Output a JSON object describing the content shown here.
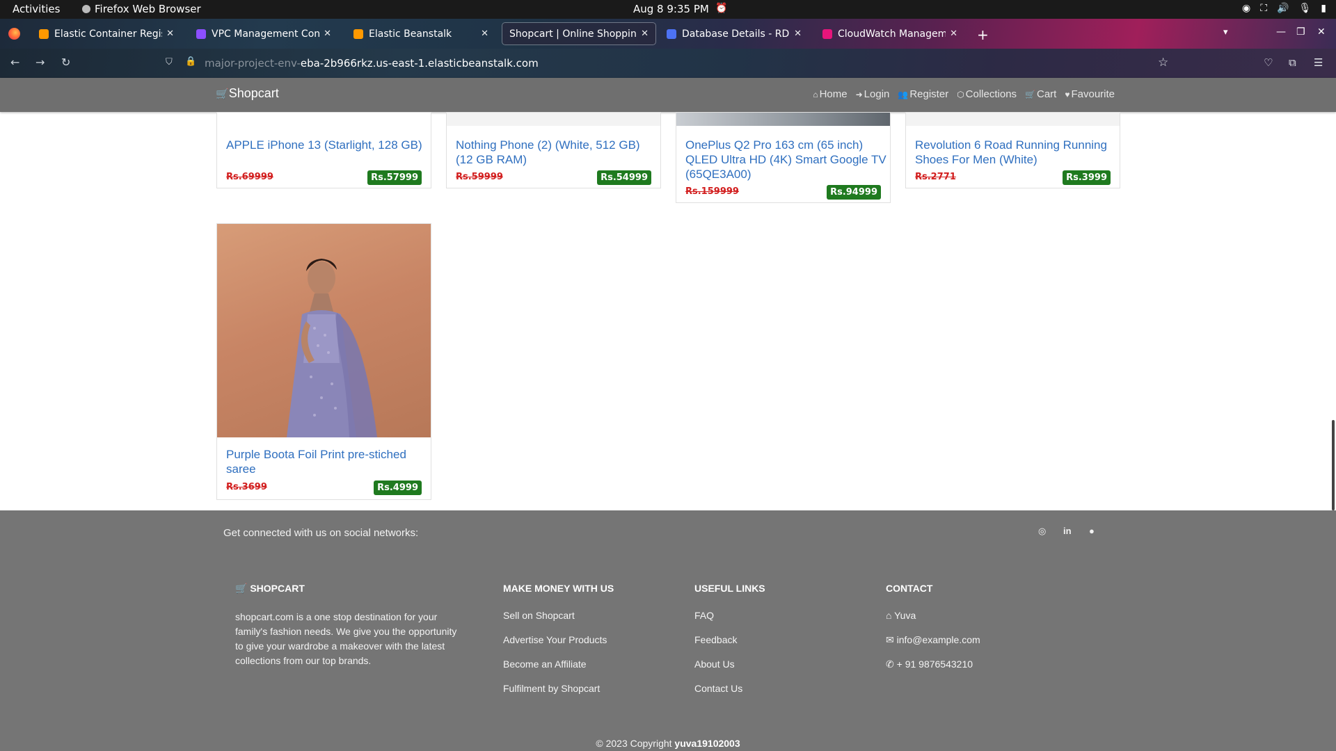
{
  "os_bar": {
    "activities": "Activities",
    "app_name": "Firefox Web Browser",
    "clock": "Aug 8  9:35 PM"
  },
  "browser": {
    "tabs": [
      {
        "label": "Elastic Container Registr",
        "favicon_color": "#ff9900",
        "active": false
      },
      {
        "label": "VPC Management Conso",
        "favicon_color": "#8c4fff",
        "active": false
      },
      {
        "label": "Elastic Beanstalk",
        "favicon_color": "#ff9900",
        "active": false
      },
      {
        "label": "Shopcart | Online Shopping",
        "favicon_color": "",
        "active": true
      },
      {
        "label": "Database Details - RDS M",
        "favicon_color": "#4d72f3",
        "active": false
      },
      {
        "label": "CloudWatch Managemen",
        "favicon_color": "#e7157b",
        "active": false
      }
    ],
    "new_tab": "+",
    "url_dim": "major-project-env-",
    "url_main": "eba-2b966rkz.us-east-1.elasticbeanstalk.com"
  },
  "site": {
    "brand": "Shopcart",
    "nav": [
      {
        "label": "Home",
        "icon": "home-icon"
      },
      {
        "label": "Login",
        "icon": "login-icon"
      },
      {
        "label": "Register",
        "icon": "users-icon"
      },
      {
        "label": "Collections",
        "icon": "cubes-icon"
      },
      {
        "label": "Cart",
        "icon": "cart-icon"
      },
      {
        "label": "Favourite",
        "icon": "heart-icon"
      }
    ]
  },
  "products": [
    {
      "title": "APPLE iPhone 13 (Starlight, 128 GB)",
      "old_price": "Rs.69999",
      "price": "Rs.57999"
    },
    {
      "title": "Nothing Phone (2) (White, 512 GB) (12 GB RAM)",
      "old_price": "Rs.59999",
      "price": "Rs.54999"
    },
    {
      "title": "OnePlus Q2 Pro 163 cm (65 inch) QLED Ultra HD (4K) Smart Google TV (65QE3A00)",
      "old_price": "Rs.159999",
      "price": "Rs.94999"
    },
    {
      "title": "Revolution 6 Road Running Running Shoes For Men (White)",
      "old_price": "Rs.2771",
      "price": "Rs.3999"
    },
    {
      "title": "Purple Boota Foil Print pre-stiched saree",
      "old_price": "Rs.3699",
      "price": "Rs.4999"
    }
  ],
  "footer": {
    "social_text": "Get connected with us on social networks:",
    "social_icons": [
      "instagram-icon",
      "linkedin-icon",
      "github-icon"
    ],
    "col1": {
      "heading": "SHOPCART",
      "text": "shopcart.com is a one stop destination for your family's fashion needs. We give you the opportunity to give your wardrobe a makeover with the latest collections from our top brands."
    },
    "col2": {
      "heading": "MAKE MONEY WITH US",
      "links": [
        "Sell on Shopcart",
        "Advertise Your Products",
        "Become an Affiliate",
        "Fulfilment by Shopcart"
      ]
    },
    "col3": {
      "heading": "USEFUL LINKS",
      "links": [
        "FAQ",
        "Feedback",
        "About Us",
        "Contact Us"
      ]
    },
    "col4": {
      "heading": "CONTACT",
      "items": [
        "Yuva",
        "info@example.com",
        "+ 91 9876543210"
      ]
    },
    "copyright_prefix": "© 2023 Copyright ",
    "copyright_owner": "yuva19102003"
  },
  "colors": {
    "site_nav_bg": "#6f6f6f",
    "footer_bg": "#757575",
    "link_blue": "#2f6fbf",
    "old_price_red": "#d21f1f",
    "price_green": "#1f7a1f"
  }
}
